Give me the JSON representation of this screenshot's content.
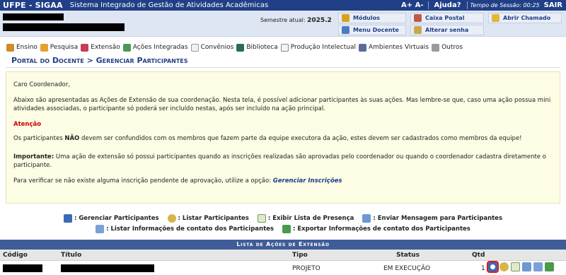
{
  "topbar": {
    "brand": "UFPE - SIGAA",
    "subtitle": "Sistema Integrado de Gestão de Atividades Acadêmicas",
    "font_controls": "A+  A-",
    "help": "Ajuda?",
    "session_label": "Tempo de Sessão: 00:25",
    "exit": "SAIR"
  },
  "info": {
    "semester_label": "Semestre atual:",
    "semester_value": "2025.2",
    "links": {
      "modulos": "Módulos",
      "caixa_postal": "Caixa Postal",
      "abrir_chamado": "Abrir Chamado",
      "menu_docente": "Menu Docente",
      "alterar_senha": "Alterar senha"
    }
  },
  "menu": [
    "Ensino",
    "Pesquisa",
    "Extensão",
    "Ações Integradas",
    "Convênios",
    "Biblioteca",
    "Produção Intelectual",
    "Ambientes Virtuais",
    "Outros"
  ],
  "breadcrumb": "Portal do Docente > Gerenciar Participantes",
  "notice": {
    "greeting": "Caro Coordenador,",
    "intro": "Abaixo são apresentadas as Ações de Extensão de sua coordenação. Nesta tela, é possível adicionar participantes às suas ações. Mas lembre-se que, caso uma ação possua mini atividades associadas, o participante só poderá ser incluído nestas, após ser incluído na ação principal.",
    "attention": "Atenção",
    "warn_pre": "Os participantes ",
    "warn_bold": "NÃO",
    "warn_post": " devem ser confundidos com os membros que fazem parte da equipe executora da ação, estes devem ser cadastrados como membros da equipe!",
    "important_label": "Importante:",
    "important_text": " Uma ação de extensão só possui participantes quando as inscrições realizadas são aprovadas pelo coordenador ou quando o coordenador cadastra diretamente o participante.",
    "verify_text": "Para verificar se não existe alguma inscrição pendente de aprovação, utilize a opção: ",
    "verify_link": "Gerenciar Inscrições"
  },
  "legend": {
    "gerenciar": ": Gerenciar Participantes",
    "listar": ": Listar Participantes",
    "presenca": ": Exibir Lista de Presença",
    "mensagem": ": Enviar Mensagem para Participantes",
    "contato": ": Listar Informações de contato dos Participantes",
    "exportar": ": Exportar Informações de contato dos Participantes"
  },
  "table": {
    "caption": "Lista de Ações de Extensão",
    "headers": {
      "codigo": "Código",
      "titulo": "Título",
      "tipo": "Tipo",
      "status": "Status",
      "qtd": "Qtd"
    },
    "rows": [
      {
        "tipo": "PROJETO",
        "status": "EM EXECUÇÃO",
        "qtd": "1"
      }
    ]
  },
  "colors": {
    "header_blue": "#203f86",
    "info_bg": "#dde6f2",
    "notice_bg": "#fdfce4",
    "attention_red": "#cc0000",
    "selection_red": "#e01818"
  },
  "icons": [
    "modules-icon",
    "mailbox-icon",
    "ticket-icon",
    "menu-icon",
    "key-icon",
    "teaching-icon",
    "research-icon",
    "extension-icon",
    "integrated-actions-icon",
    "agreements-icon",
    "library-icon",
    "production-icon",
    "virtual-env-icon",
    "others-icon",
    "manage-participants-icon",
    "magnifier-icon",
    "attendance-icon",
    "send-message-icon",
    "contact-list-icon",
    "export-icon"
  ]
}
